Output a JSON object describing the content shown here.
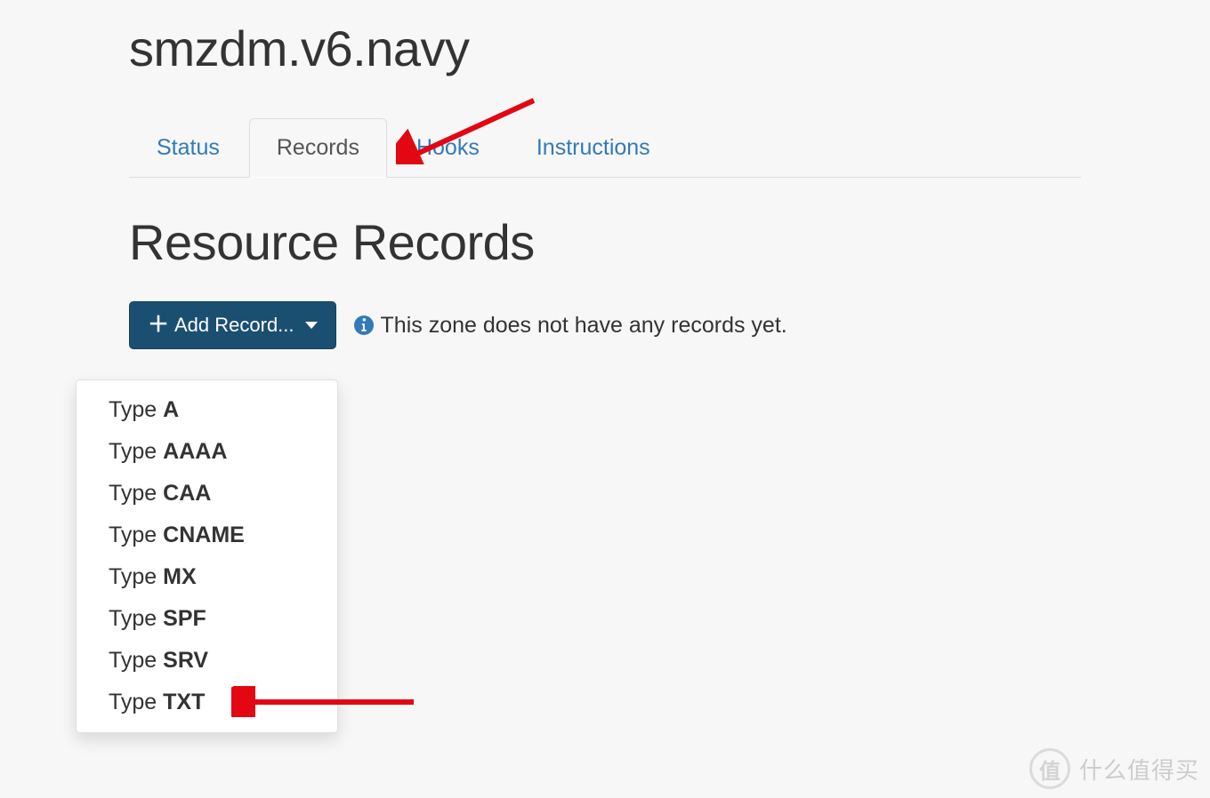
{
  "header": {
    "domain_title": "smzdm.v6.navy"
  },
  "tabs": [
    {
      "id": "status",
      "label": "Status",
      "active": false
    },
    {
      "id": "records",
      "label": "Records",
      "active": true
    },
    {
      "id": "hooks",
      "label": "Hooks",
      "active": false
    },
    {
      "id": "instructions",
      "label": "Instructions",
      "active": false
    }
  ],
  "section": {
    "title": "Resource Records"
  },
  "toolbar": {
    "add_button_label": "Add Record..."
  },
  "empty_state": {
    "message": "This zone does not have any records yet."
  },
  "dropdown": {
    "label_prefix": "Type ",
    "items": [
      {
        "type": "A"
      },
      {
        "type": "AAAA"
      },
      {
        "type": "CAA"
      },
      {
        "type": "CNAME"
      },
      {
        "type": "MX"
      },
      {
        "type": "SPF"
      },
      {
        "type": "SRV"
      },
      {
        "type": "TXT"
      }
    ]
  },
  "watermark": {
    "badge": "值",
    "text": "什么值得买"
  }
}
